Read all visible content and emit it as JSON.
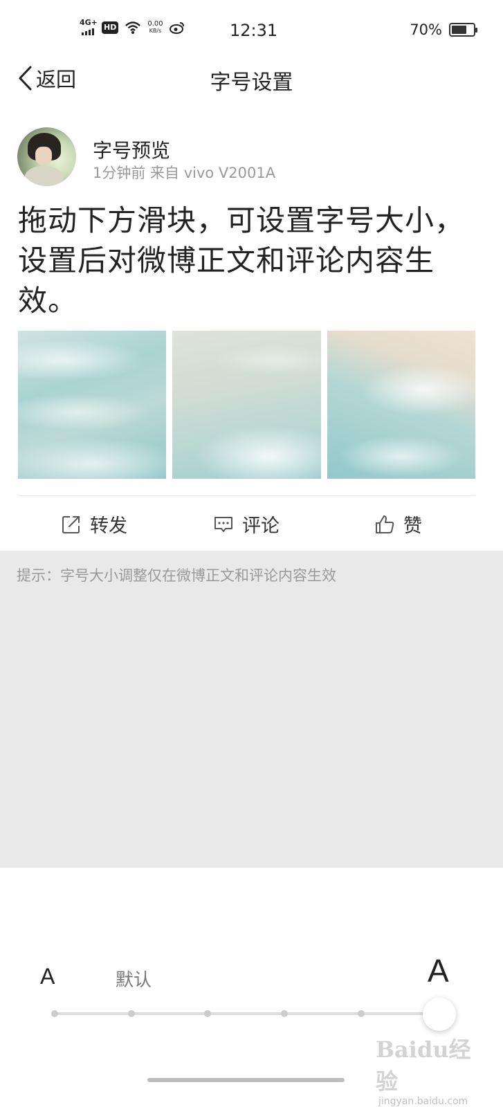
{
  "status_bar": {
    "network": "4G+",
    "hd_badge": "HD",
    "speed_value": "0.00",
    "speed_unit": "KB/s",
    "time": "12:31",
    "battery_text": "70%",
    "battery_level": 0.7
  },
  "nav": {
    "back_label": "返回",
    "title": "字号设置"
  },
  "post": {
    "username": "字号预览",
    "meta": "1分钟前  来自 vivo V2001A",
    "text": "拖动下方滑块，可设置字号大小，设置后对微博正文和评论内容生效。",
    "image_count": 3
  },
  "actions": {
    "repost": "转发",
    "comment": "评论",
    "like": "赞"
  },
  "tip": "提示：字号大小调整仅在微博正文和评论内容生效",
  "font_slider": {
    "small_label": "A",
    "default_label": "默认",
    "large_label": "A",
    "steps": 6,
    "selected_step": 6
  },
  "watermark": {
    "logo_text": "Baidu经验",
    "url": "jingyan.baidu.com"
  }
}
